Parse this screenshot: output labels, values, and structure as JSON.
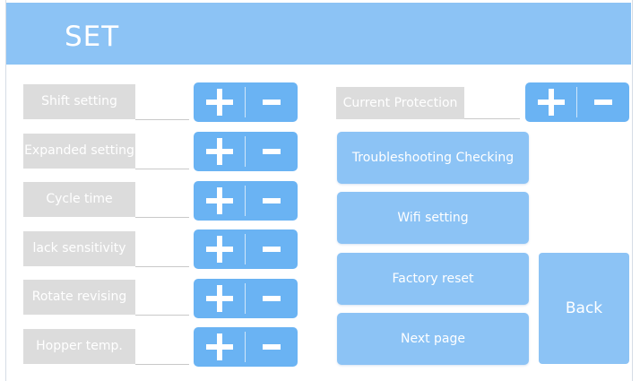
{
  "header": {
    "title": "SET"
  },
  "settings": [
    {
      "label": "Shift setting"
    },
    {
      "label": "Expanded setting"
    },
    {
      "label": "Cycle time"
    },
    {
      "label": "lack sensitivity"
    },
    {
      "label": "Rotate revising"
    },
    {
      "label": "Hopper temp."
    }
  ],
  "current_protection": {
    "label": "Current Protection"
  },
  "buttons": {
    "troubleshooting": "Troubleshooting Checking",
    "wifi": "Wifi setting",
    "factory_reset": "Factory reset",
    "next_page": "Next page",
    "back": "Back"
  },
  "icons": {
    "plus": "plus-icon",
    "minus": "minus-icon"
  },
  "colors": {
    "header": "#8cc3f5",
    "button": "#8cc3f5",
    "stepper": "#6ab3f3",
    "label_bg": "#dcdcdc",
    "text": "#ffffff"
  }
}
